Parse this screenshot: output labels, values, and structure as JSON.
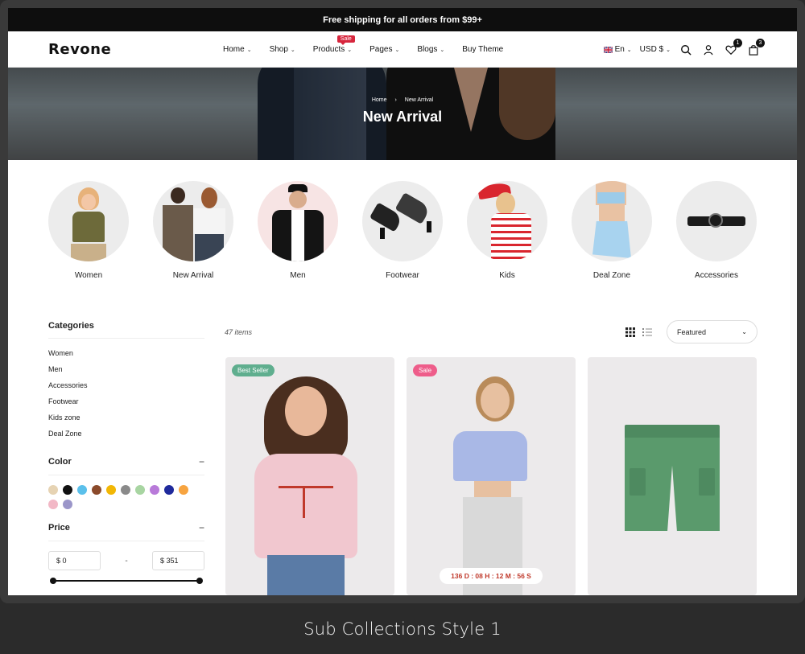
{
  "announcement": "Free shipping for all orders from $99+",
  "logo": "Revone",
  "nav": [
    {
      "label": "Home",
      "chevron": true
    },
    {
      "label": "Shop",
      "chevron": true
    },
    {
      "label": "Products",
      "chevron": true,
      "tag": "Sale"
    },
    {
      "label": "Pages",
      "chevron": true
    },
    {
      "label": "Blogs",
      "chevron": true
    },
    {
      "label": "Buy Theme",
      "chevron": false
    }
  ],
  "header": {
    "language": "En",
    "currency": "USD $",
    "wishlist_count": "1",
    "cart_count": "3"
  },
  "hero": {
    "breadcrumb_home": "Home",
    "breadcrumb_current": "New Arrival",
    "title": "New Arrival"
  },
  "collections": [
    {
      "label": "Women"
    },
    {
      "label": "New Arrival"
    },
    {
      "label": "Men"
    },
    {
      "label": "Footwear"
    },
    {
      "label": "Kids"
    },
    {
      "label": "Deal Zone"
    },
    {
      "label": "Accessories"
    }
  ],
  "sidebar": {
    "categories_title": "Categories",
    "categories": [
      "Women",
      "Men",
      "Accessories",
      "Footwear",
      "Kids zone",
      "Deal Zone"
    ],
    "color_title": "Color",
    "colors": [
      "#e6d3b3",
      "#111111",
      "#5bc0eb",
      "#8b4a2b",
      "#f2b705",
      "#8a8a8a",
      "#a8d5a2",
      "#b87ad9",
      "#1f2a9c",
      "#f7a440",
      "#f2b8c6",
      "#9b96c9"
    ],
    "price_title": "Price",
    "price_min": "$ 0",
    "price_max": "$ 351",
    "price_separator": "-",
    "collapse_symbol": "−"
  },
  "toolbar": {
    "items_count": "47 items",
    "sort_label": "Featured"
  },
  "products": [
    {
      "badge": "Best Seller",
      "badge_color": "#5fae8e"
    },
    {
      "badge": "Sale",
      "badge_color": "#ee5d8a",
      "countdown": "136 D : 08 H : 12 M : 56 S"
    },
    {
      "badge": "",
      "badge_color": ""
    }
  ],
  "caption": "Sub Collections Style 1"
}
